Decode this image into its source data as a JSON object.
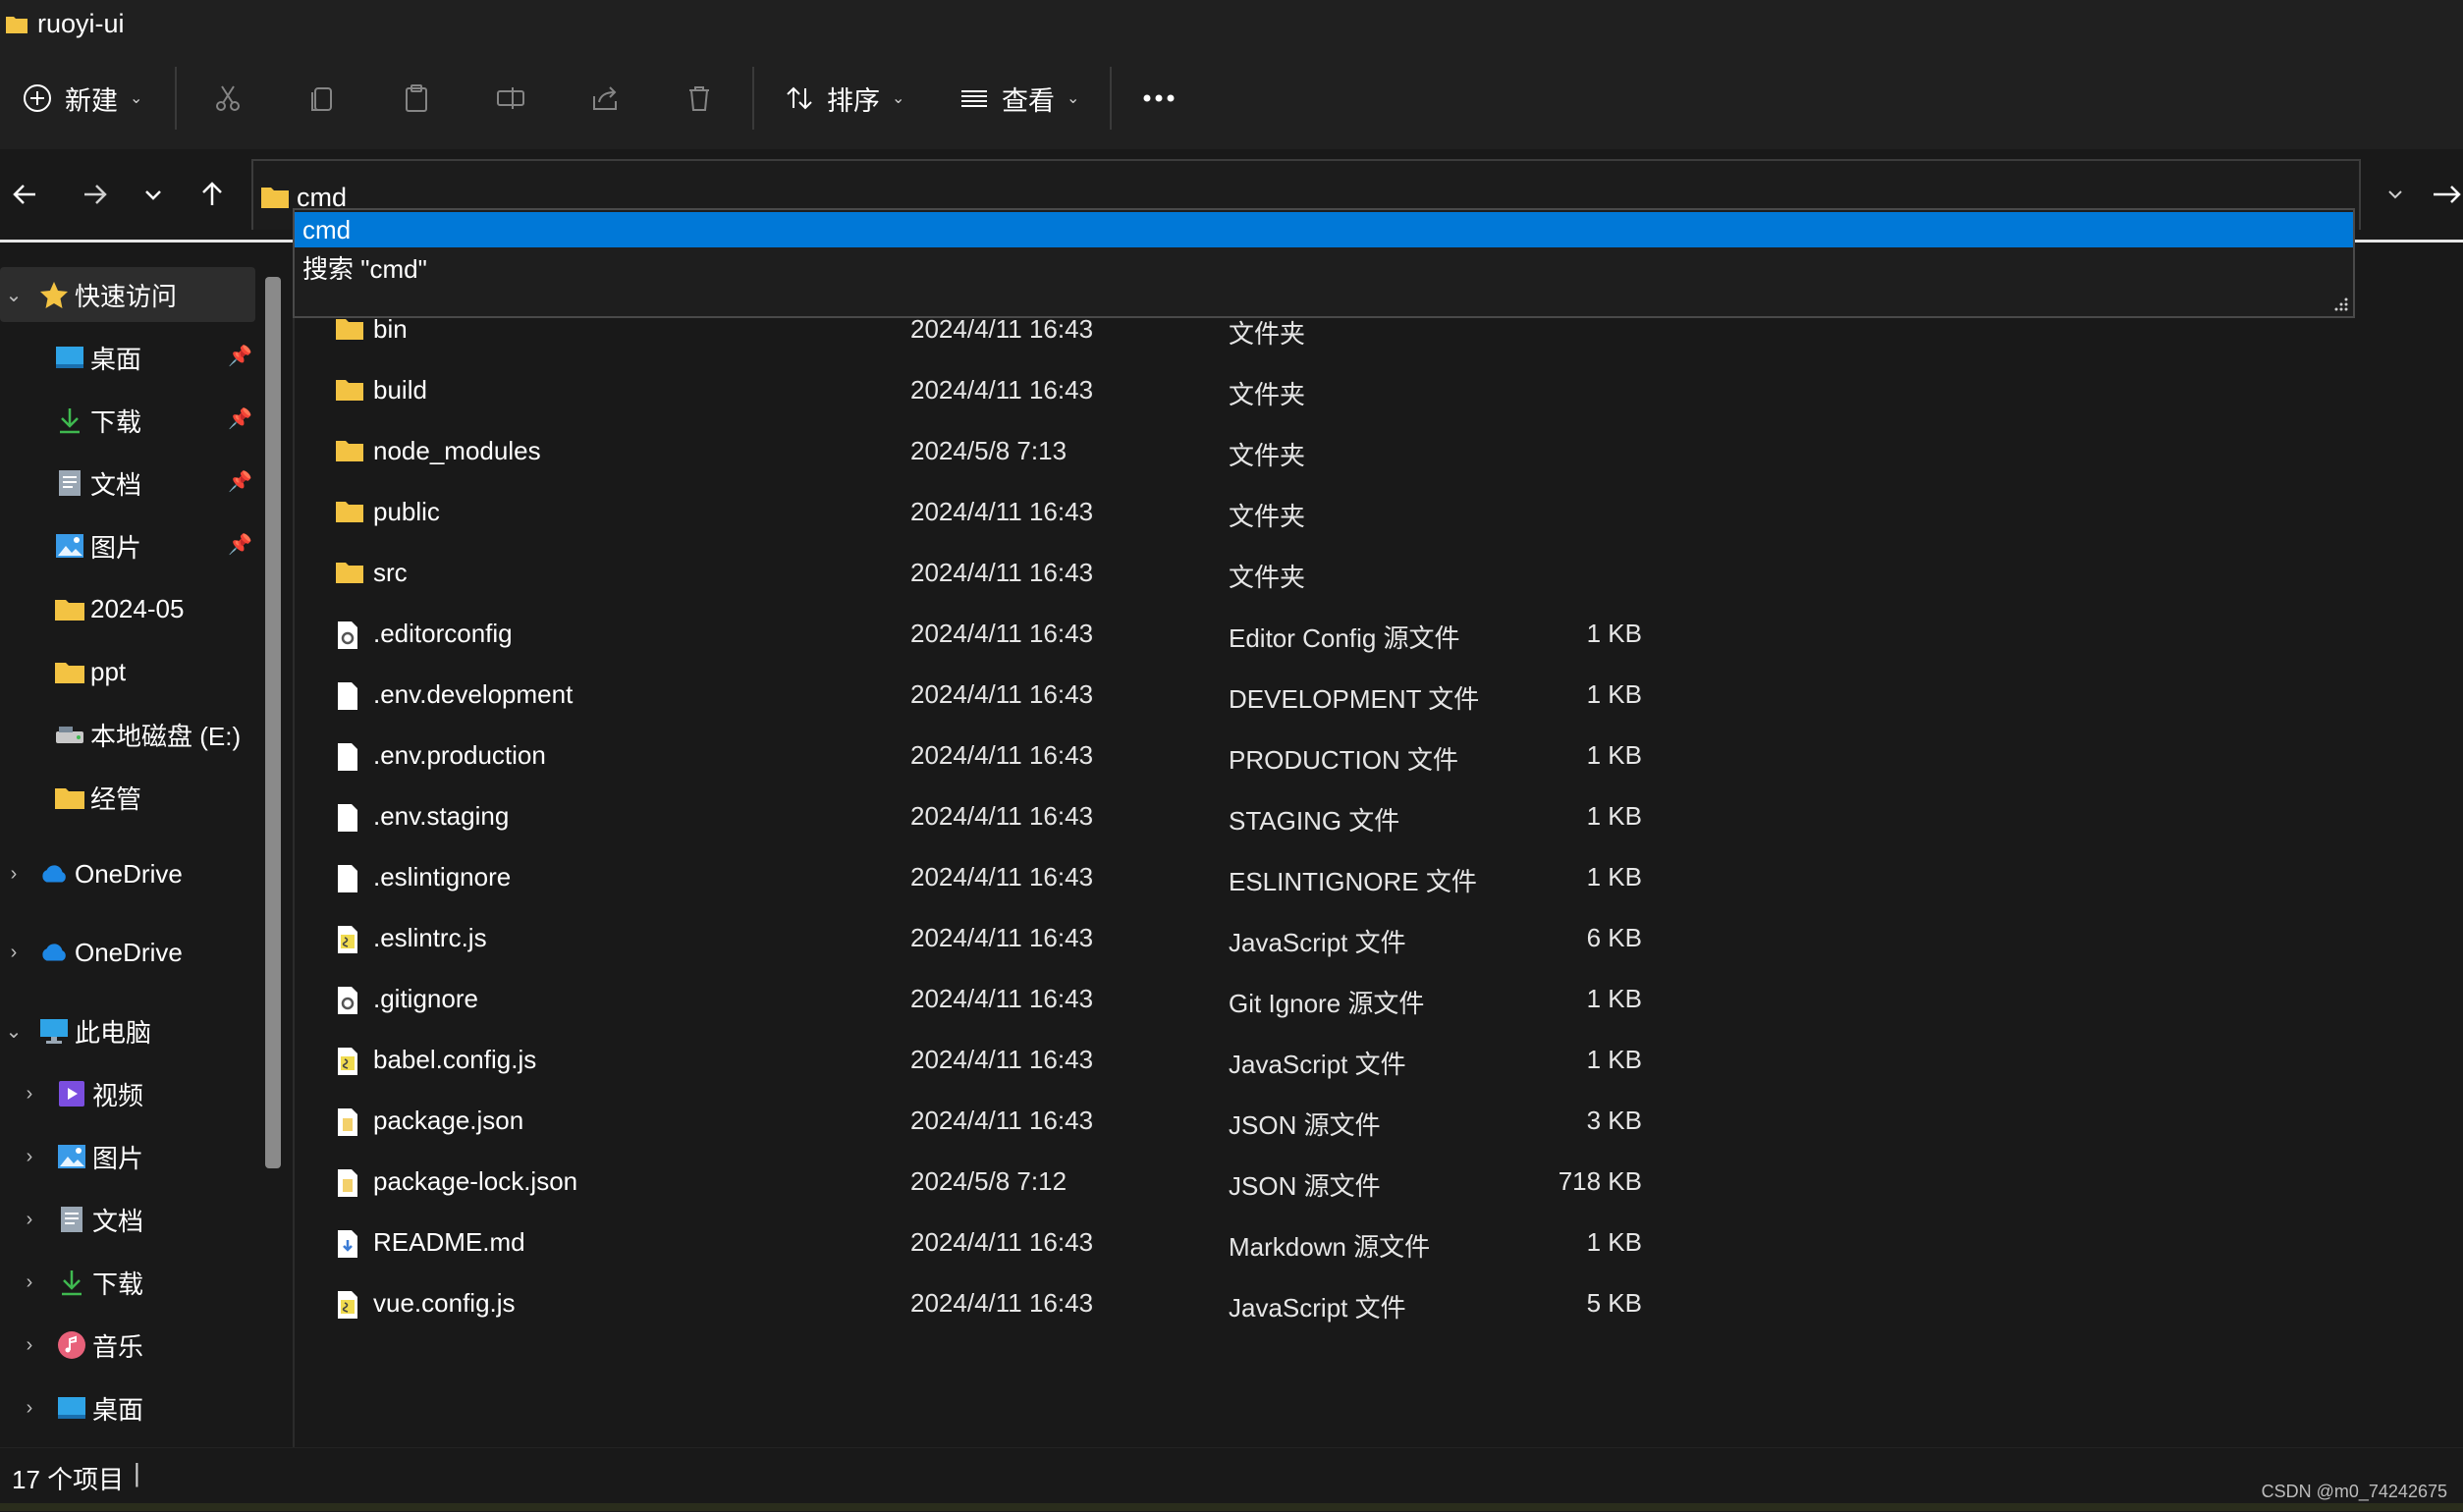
{
  "window": {
    "title": "ruoyi-ui"
  },
  "toolbar": {
    "new_label": "新建",
    "sort_label": "排序",
    "view_label": "查看",
    "more_icon": "more-icon"
  },
  "address": {
    "value": "cmd",
    "suggestions": [
      "cmd",
      "搜索 \"cmd\""
    ]
  },
  "sidebar": {
    "quick_access": "快速访问",
    "quick_items": [
      {
        "label": "桌面",
        "pinned": true
      },
      {
        "label": "下载",
        "pinned": true
      },
      {
        "label": "文档",
        "pinned": true
      },
      {
        "label": "图片",
        "pinned": true
      },
      {
        "label": "2024-05",
        "pinned": false
      },
      {
        "label": "ppt",
        "pinned": false
      },
      {
        "label": "本地磁盘 (E:)",
        "pinned": false
      },
      {
        "label": "经管",
        "pinned": false
      }
    ],
    "onedrive1": "OneDrive",
    "onedrive2": "OneDrive",
    "this_pc": "此电脑",
    "pc_items": [
      "视频",
      "图片",
      "文档",
      "下载",
      "音乐",
      "桌面"
    ]
  },
  "files": [
    {
      "name": "bin",
      "date": "2024/4/11 16:43",
      "type": "文件夹",
      "size": "",
      "icon": "folder-icon"
    },
    {
      "name": "build",
      "date": "2024/4/11 16:43",
      "type": "文件夹",
      "size": "",
      "icon": "folder-icon"
    },
    {
      "name": "node_modules",
      "date": "2024/5/8 7:13",
      "type": "文件夹",
      "size": "",
      "icon": "folder-icon"
    },
    {
      "name": "public",
      "date": "2024/4/11 16:43",
      "type": "文件夹",
      "size": "",
      "icon": "folder-icon"
    },
    {
      "name": "src",
      "date": "2024/4/11 16:43",
      "type": "文件夹",
      "size": "",
      "icon": "folder-icon"
    },
    {
      "name": ".editorconfig",
      "date": "2024/4/11 16:43",
      "type": "Editor Config 源文件",
      "size": "1 KB",
      "icon": "config-file-icon"
    },
    {
      "name": ".env.development",
      "date": "2024/4/11 16:43",
      "type": "DEVELOPMENT 文件",
      "size": "1 KB",
      "icon": "file-icon"
    },
    {
      "name": ".env.production",
      "date": "2024/4/11 16:43",
      "type": "PRODUCTION 文件",
      "size": "1 KB",
      "icon": "file-icon"
    },
    {
      "name": ".env.staging",
      "date": "2024/4/11 16:43",
      "type": "STAGING 文件",
      "size": "1 KB",
      "icon": "file-icon"
    },
    {
      "name": ".eslintignore",
      "date": "2024/4/11 16:43",
      "type": "ESLINTIGNORE 文件",
      "size": "1 KB",
      "icon": "file-icon"
    },
    {
      "name": ".eslintrc.js",
      "date": "2024/4/11 16:43",
      "type": "JavaScript 文件",
      "size": "6 KB",
      "icon": "js-file-icon"
    },
    {
      "name": ".gitignore",
      "date": "2024/4/11 16:43",
      "type": "Git Ignore 源文件",
      "size": "1 KB",
      "icon": "config-file-icon"
    },
    {
      "name": "babel.config.js",
      "date": "2024/4/11 16:43",
      "type": "JavaScript 文件",
      "size": "1 KB",
      "icon": "js-file-icon"
    },
    {
      "name": "package.json",
      "date": "2024/4/11 16:43",
      "type": "JSON 源文件",
      "size": "3 KB",
      "icon": "json-file-icon"
    },
    {
      "name": "package-lock.json",
      "date": "2024/5/8 7:12",
      "type": "JSON 源文件",
      "size": "718 KB",
      "icon": "json-file-icon"
    },
    {
      "name": "README.md",
      "date": "2024/4/11 16:43",
      "type": "Markdown 源文件",
      "size": "1 KB",
      "icon": "markdown-file-icon"
    },
    {
      "name": "vue.config.js",
      "date": "2024/4/11 16:43",
      "type": "JavaScript 文件",
      "size": "5 KB",
      "icon": "js-file-icon"
    }
  ],
  "status": {
    "item_count": "17 个项目"
  },
  "watermark": "CSDN @m0_74242675",
  "colors": {
    "accent": "#0078d7",
    "folder": "#f3c343",
    "background": "#191919"
  }
}
